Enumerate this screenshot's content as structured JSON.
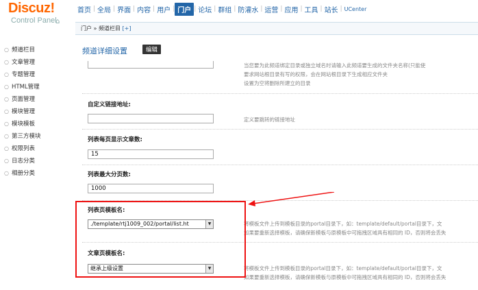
{
  "logo": {
    "brand": "Discuz!",
    "sub": "Control Panel",
    "home_icon": "home-icon"
  },
  "topnav": {
    "items": [
      "首页",
      "全局",
      "界面",
      "内容",
      "用户",
      "门户",
      "论坛",
      "群组",
      "防灌水",
      "运营",
      "应用",
      "工具",
      "站长",
      "UCenter"
    ],
    "active": "门户"
  },
  "breadcrumb": {
    "text": "门户 » 频道栏目",
    "plus": "[+]"
  },
  "sidebar": {
    "items": [
      "频道栏目",
      "文章管理",
      "专题管理",
      "HTML管理",
      "页面管理",
      "模块管理",
      "模块模板",
      "第三方模块",
      "权限列表",
      "日志分类",
      "相册分类"
    ]
  },
  "main": {
    "title": "频道详细设置",
    "edit_label": "编辑",
    "top_tip": [
      "当您要为此频道绑定目录或独立域名时请输入此频道要生成的文件夹名称(只能使",
      "要求网站根目录有写的权限，会在网站根目录下生成相应文件夹",
      "设置为空将删除所建立的目录"
    ],
    "custom_url": {
      "label": "自定义链接地址:",
      "value": "",
      "tip": "定义要跳转的链接地址"
    },
    "per_page": {
      "label": "列表每页显示文章数:",
      "value": "15"
    },
    "max_page": {
      "label": "列表最大分页数:",
      "value": "1000"
    },
    "list_tpl": {
      "label": "列表页模板名:",
      "value": "./template/rtj1009_002/portal/list.ht",
      "tip": [
        "将模板文件上传到模板目录的portal目录下，如：template/default/portal目录下，文",
        "如果要重新选择模板，请确保新模板与原模板中可拖拽区域具有相同的 ID，否则将会丢失"
      ]
    },
    "article_tpl": {
      "label": "文章页模板名:",
      "value": "继承上级设置",
      "tip": [
        "将模板文件上传到模板目录的portal目录下，如：template/default/portal目录下，文",
        "如果要重新选择模板，请确保新模板与原模板中可拖拽区域具有相同的 ID，否则将会丢失"
      ]
    }
  },
  "annotation": {
    "color": "#e11111"
  }
}
